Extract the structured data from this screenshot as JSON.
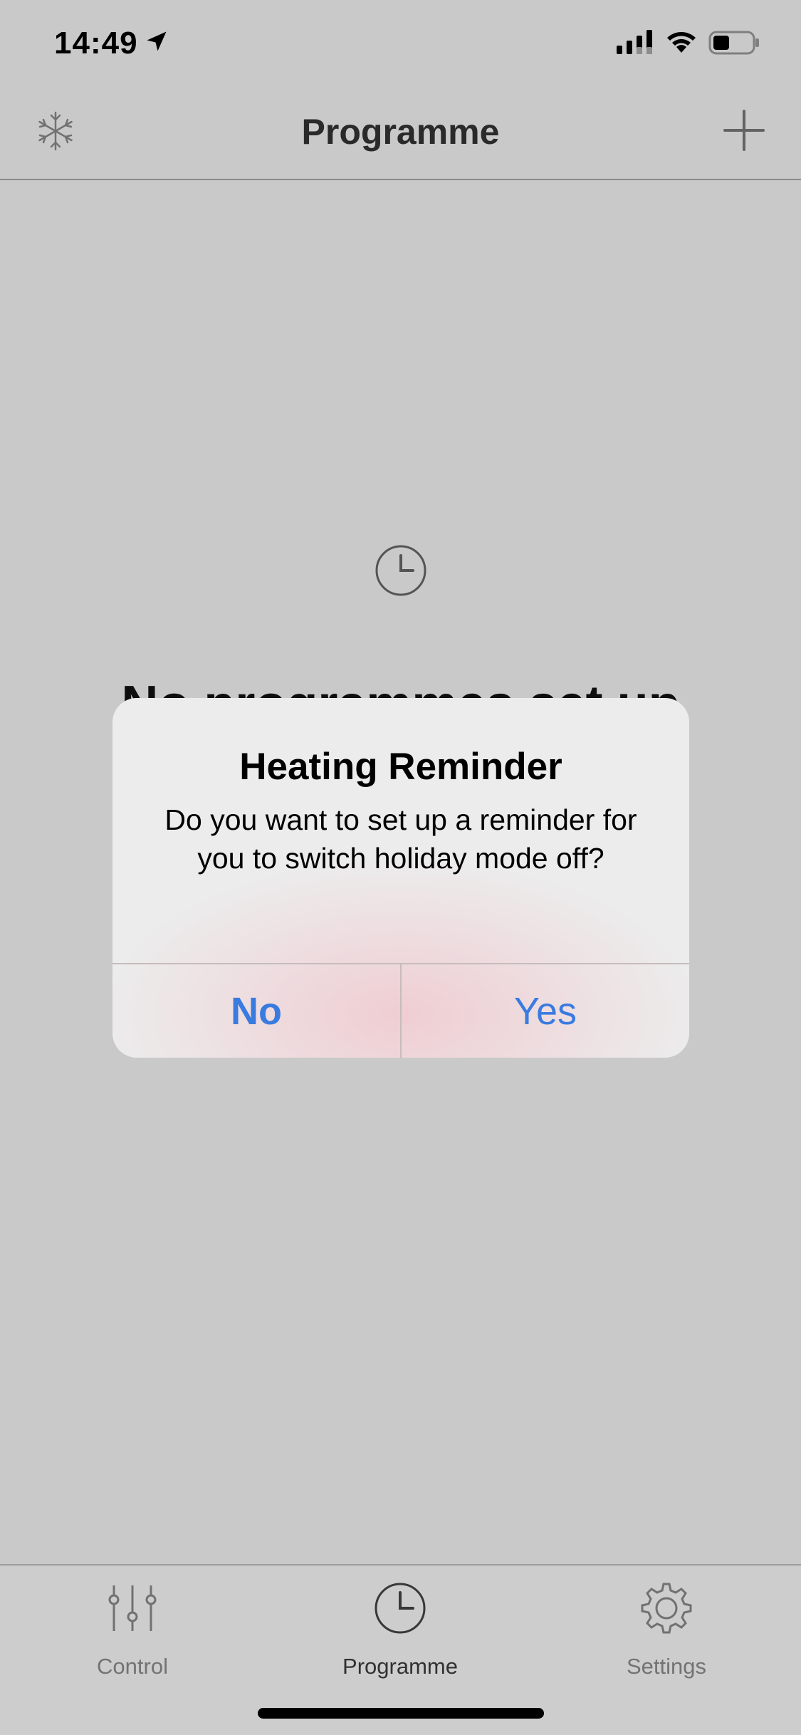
{
  "status_bar": {
    "time": "14:49",
    "icons": [
      "location-arrow-icon",
      "cellular-signal-icon",
      "wifi-icon",
      "battery-icon"
    ]
  },
  "nav": {
    "title": "Programme",
    "left_icon": "snowflake-icon",
    "right_icon": "plus-icon"
  },
  "empty_state": {
    "icon": "clock-icon",
    "title": "No programmes set up"
  },
  "alert": {
    "title": "Heating Reminder",
    "message": "Do you want to set up a reminder for you to switch holiday mode off?",
    "no_label": "No",
    "yes_label": "Yes",
    "button_color": "#3a7be0"
  },
  "tab_bar": {
    "tabs": [
      {
        "label": "Control",
        "icon": "sliders-icon",
        "active": false
      },
      {
        "label": "Programme",
        "icon": "clock-icon",
        "active": true
      },
      {
        "label": "Settings",
        "icon": "gear-icon",
        "active": false
      }
    ]
  }
}
